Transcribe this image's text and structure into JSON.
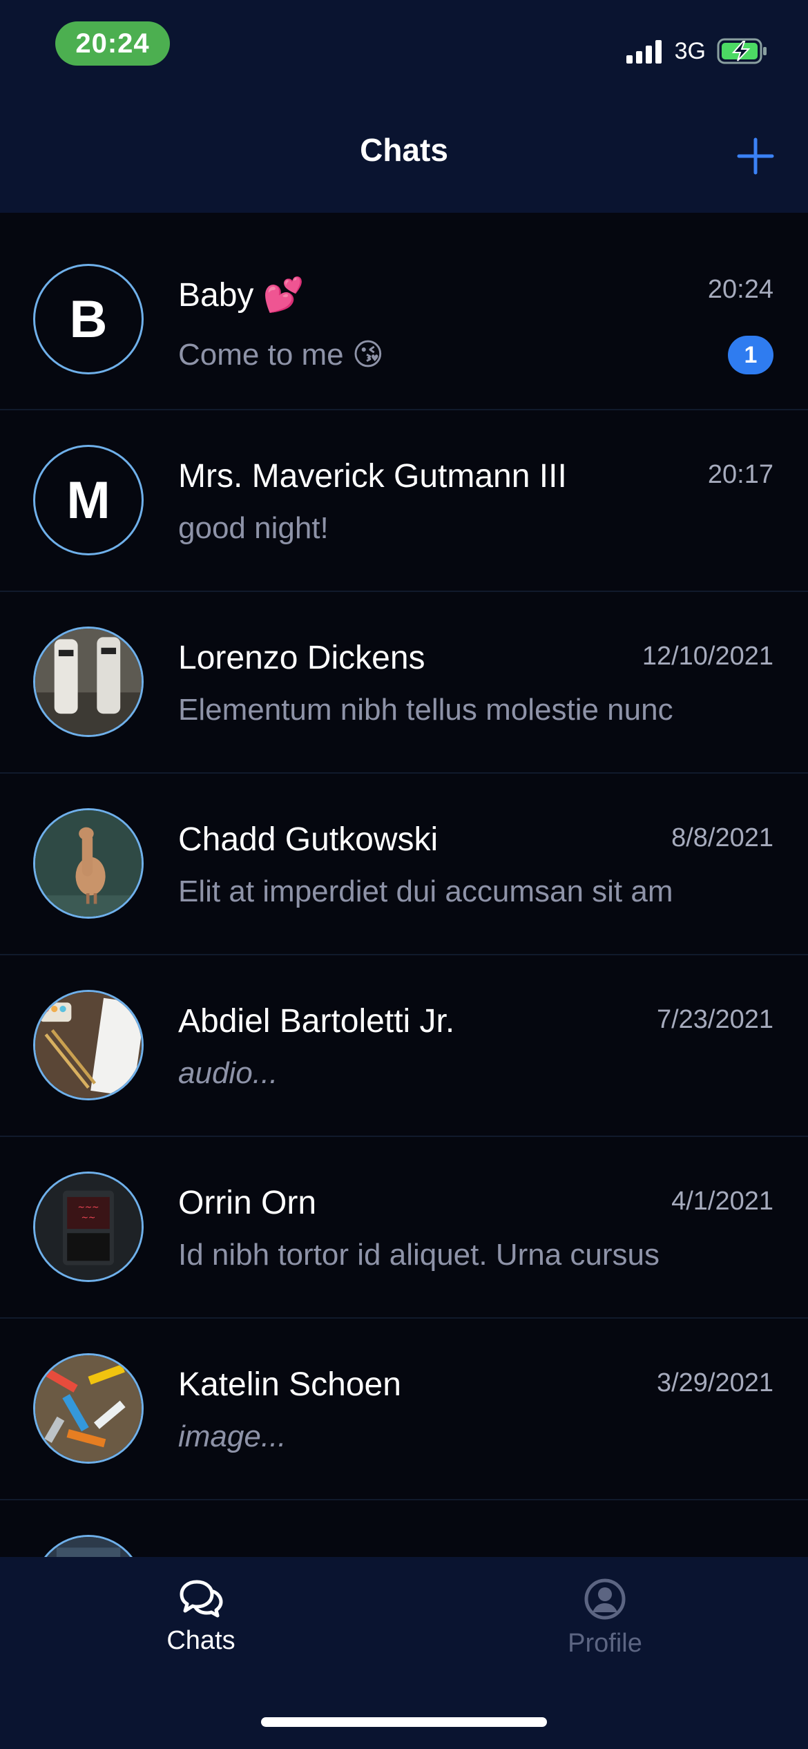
{
  "status_bar": {
    "time": "20:24",
    "network": "3G"
  },
  "header": {
    "title": "Chats",
    "add_icon": "plus-icon"
  },
  "chats": [
    {
      "name": "Baby 💕",
      "preview": "Come to me 😘",
      "time": "20:24",
      "unread": "1",
      "avatar_letter": "B"
    },
    {
      "name": "Mrs. Maverick Gutmann III",
      "preview": "good night!",
      "time": "20:17",
      "avatar_letter": "M"
    },
    {
      "name": "Lorenzo Dickens",
      "preview": "Elementum nibh tellus molestie nunc",
      "time": "12/10/2021",
      "avatar_image": "photo-stormtroopers"
    },
    {
      "name": "Chadd Gutkowski",
      "preview": "Elit at imperdiet dui accumsan sit am",
      "time": "8/8/2021",
      "avatar_image": "photo-wooden-duck"
    },
    {
      "name": "Abdiel Bartoletti Jr.",
      "preview": "audio...",
      "time": "7/23/2021",
      "avatar_image": "photo-notebook-brushes"
    },
    {
      "name": "Orrin Orn",
      "preview": "Id nibh tortor id aliquet. Urna cursus",
      "time": "4/1/2021",
      "avatar_image": "photo-neon-sign"
    },
    {
      "name": "Katelin Schoen",
      "preview": "image...",
      "time": "3/29/2021",
      "avatar_image": "photo-colorful-pile"
    }
  ],
  "tabbar": {
    "chats_label": "Chats",
    "profile_label": "Profile",
    "active_tab": "Chats"
  },
  "colors": {
    "header_bg": "#0a1430",
    "list_bg": "#05070f",
    "accent": "#2f7cf0",
    "avatar_ring": "#6fb0ea",
    "status_time_bg": "#4caf50"
  }
}
